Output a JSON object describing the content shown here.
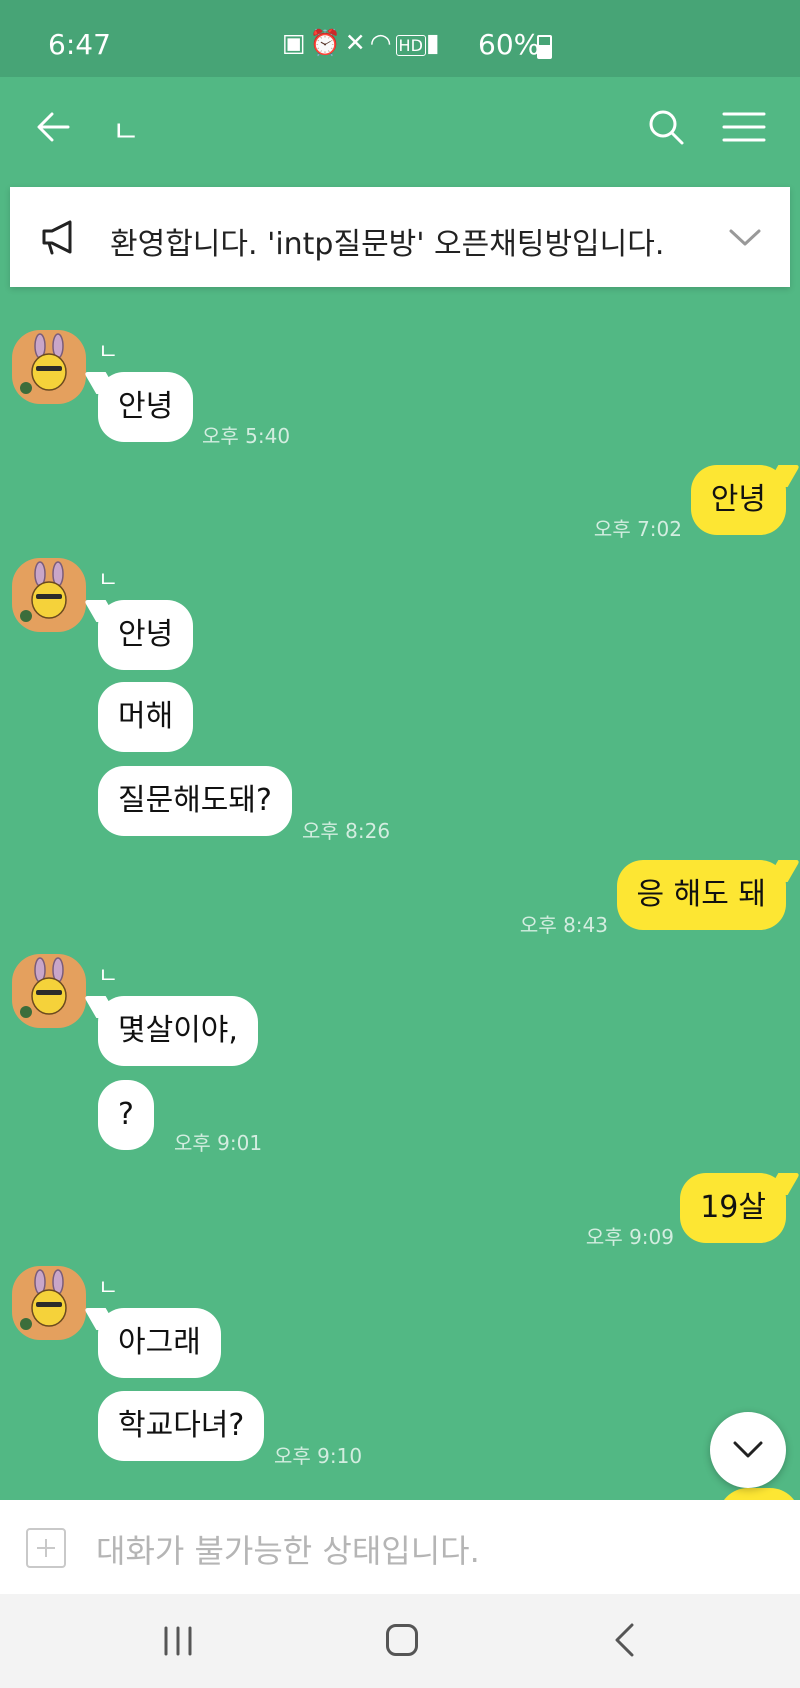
{
  "status_bar": {
    "time": "6:47",
    "icons": [
      "battery-saver-icon",
      "alarm-icon",
      "mute-icon",
      "wifi-icon",
      "hd-icon",
      "signal-icon"
    ],
    "battery_percent": "60%"
  },
  "header": {
    "title": "ㄴ"
  },
  "notice": {
    "text": "환영합니다. 'intp질문방' 오픈채팅방입니다."
  },
  "messages": [
    {
      "sender": "ㄴ",
      "lines": [
        "안녕"
      ],
      "time": "오후 5:40"
    },
    {
      "mine": true,
      "lines": [
        "안녕"
      ],
      "time": "오후 7:02"
    },
    {
      "sender": "ㄴ",
      "lines": [
        "안녕",
        "머해",
        "질문해도돼?"
      ],
      "time": "오후 8:26"
    },
    {
      "mine": true,
      "lines": [
        "응 해도 돼"
      ],
      "time": "오후 8:43"
    },
    {
      "sender": "ㄴ",
      "lines": [
        "몇살이야,",
        "?"
      ],
      "time": "오후 9:01"
    },
    {
      "mine": true,
      "lines": [
        "19살"
      ],
      "time": "오후 9:09"
    },
    {
      "sender": "ㄴ",
      "lines": [
        "아그래",
        "학교다녀?"
      ],
      "time": "오후 9:10"
    }
  ],
  "input": {
    "placeholder": "대화가 불가능한 상태입니다."
  },
  "colors": {
    "background": "#52b884",
    "status_bar": "#47a476",
    "my_bubble": "#fde633",
    "other_bubble": "#ffffff"
  }
}
